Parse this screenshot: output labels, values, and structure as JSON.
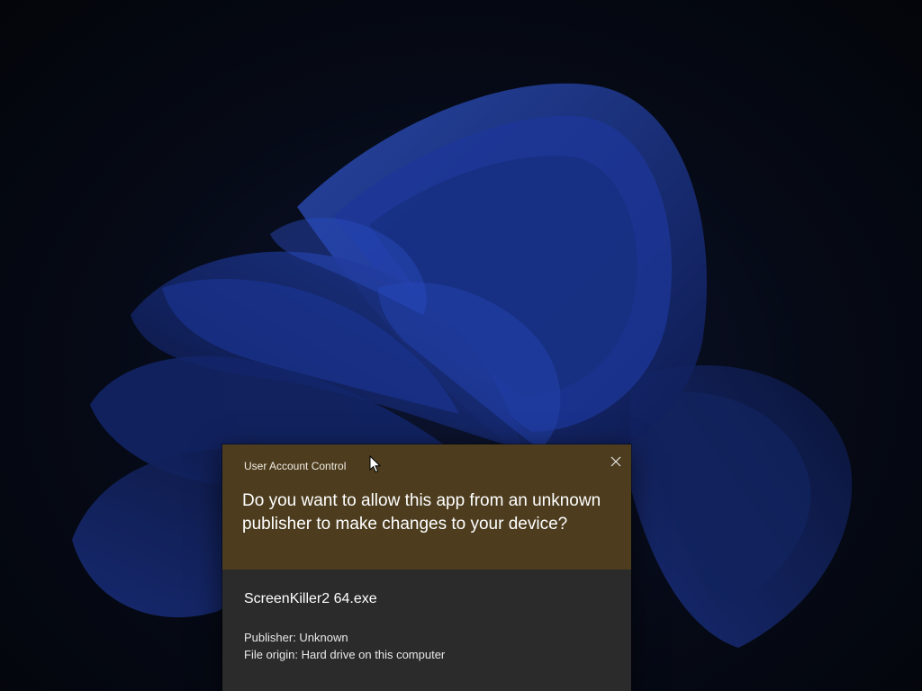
{
  "desktop": {
    "wallpaper": "windows-11-bloom"
  },
  "uac_dialog": {
    "title": "User Account Control",
    "question": "Do you want to allow this app from an unknown publisher to make changes to your device?",
    "app_name": "ScreenKiller2 64.exe",
    "publisher_label": "Publisher: Unknown",
    "file_origin_label": "File origin: Hard drive on this computer",
    "close_icon": "close-icon",
    "colors": {
      "header_bg": "#4d3d1e",
      "body_bg": "#2b2b2b",
      "text": "#ffffff"
    }
  },
  "cursor": {
    "icon": "mouse-pointer-icon"
  }
}
